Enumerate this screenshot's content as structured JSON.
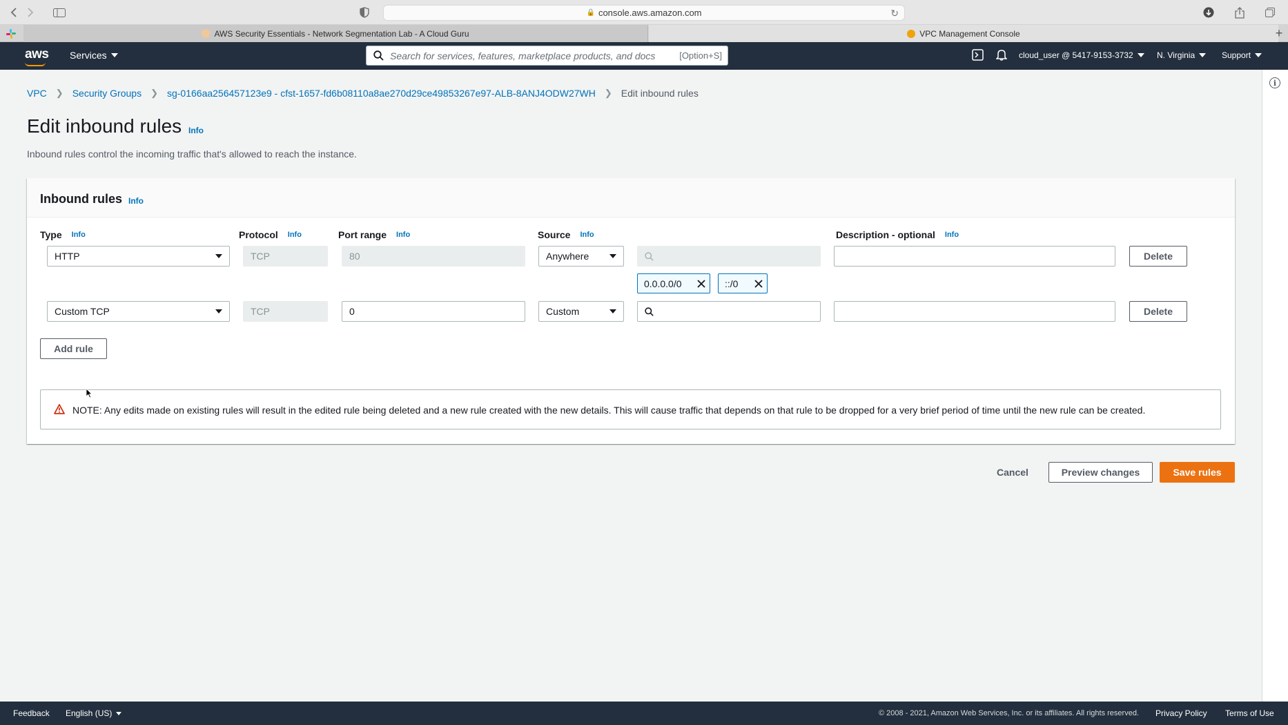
{
  "browser": {
    "url": "console.aws.amazon.com",
    "tabs": [
      {
        "label": "AWS Security Essentials - Network Segmentation Lab - A Cloud Guru"
      },
      {
        "label": "VPC Management Console"
      }
    ]
  },
  "nav": {
    "logo": "aws",
    "services": "Services",
    "search_placeholder": "Search for services, features, marketplace products, and docs",
    "search_shortcut": "[Option+S]",
    "user": "cloud_user @ 5417-9153-3732",
    "region": "N. Virginia",
    "support": "Support"
  },
  "breadcrumb": {
    "vpc": "VPC",
    "security_groups": "Security Groups",
    "sg_id": "sg-0166aa256457123e9 - cfst-1657-fd6b08110a8ae270d29ce49853267e97-ALB-8ANJ4ODW27WH",
    "current": "Edit inbound rules"
  },
  "page": {
    "title": "Edit inbound rules",
    "info": "Info",
    "description": "Inbound rules control the incoming traffic that's allowed to reach the instance."
  },
  "panel": {
    "title": "Inbound rules",
    "columns": {
      "type": "Type",
      "protocol": "Protocol",
      "port_range": "Port range",
      "source": "Source",
      "description": "Description - optional"
    },
    "rules": [
      {
        "type": "HTTP",
        "protocol": "TCP",
        "port_range": "80",
        "source": "Anywhere",
        "search": "",
        "tokens": [
          "0.0.0.0/0",
          "::/0"
        ],
        "description": "",
        "delete": "Delete"
      },
      {
        "type": "Custom TCP",
        "protocol": "TCP",
        "port_range": "0",
        "source": "Custom",
        "search": "",
        "tokens": [],
        "description": "",
        "delete": "Delete"
      }
    ],
    "add_rule": "Add rule",
    "note": "NOTE: Any edits made on existing rules will result in the edited rule being deleted and a new rule created with the new details. This will cause traffic that depends on that rule to be dropped for a very brief period of time until the new rule can be created."
  },
  "actions": {
    "cancel": "Cancel",
    "preview": "Preview changes",
    "save": "Save rules"
  },
  "footer": {
    "feedback": "Feedback",
    "language": "English (US)",
    "copyright": "© 2008 - 2021, Amazon Web Services, Inc. or its affiliates. All rights reserved.",
    "privacy": "Privacy Policy",
    "terms": "Terms of Use"
  },
  "colors": {
    "nav_bg": "#232f3e",
    "link": "#0073bb",
    "primary_button": "#ec7211",
    "warning": "#d13212"
  }
}
